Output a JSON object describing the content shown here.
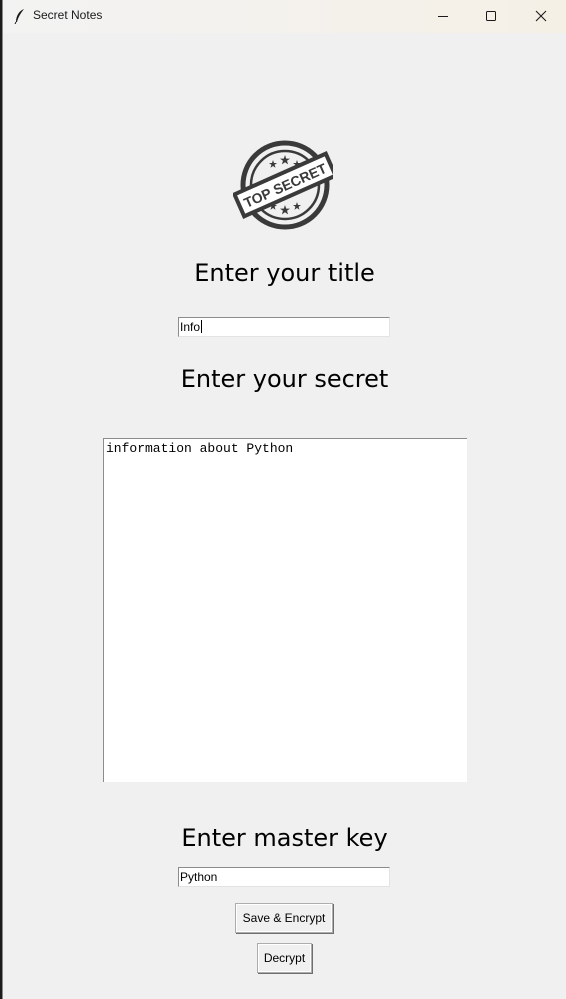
{
  "window": {
    "title": "Secret Notes",
    "icon": "feather-icon",
    "controls": [
      "minimize-icon",
      "maximize-icon",
      "close-icon"
    ]
  },
  "logo": {
    "icon": "top-secret-stamp-icon",
    "text": "TOP SECRET"
  },
  "form": {
    "title_label": "Enter your title",
    "title_value": "Info",
    "secret_label": "Enter your secret",
    "secret_value": "information about Python",
    "master_label": "Enter master key",
    "master_value": "Python",
    "save_button": "Save & Encrypt",
    "decrypt_button": "Decrypt"
  },
  "colors": {
    "window_background": "#f0f0f0",
    "input_background": "#ffffff",
    "stamp": "#3a3a3a"
  }
}
